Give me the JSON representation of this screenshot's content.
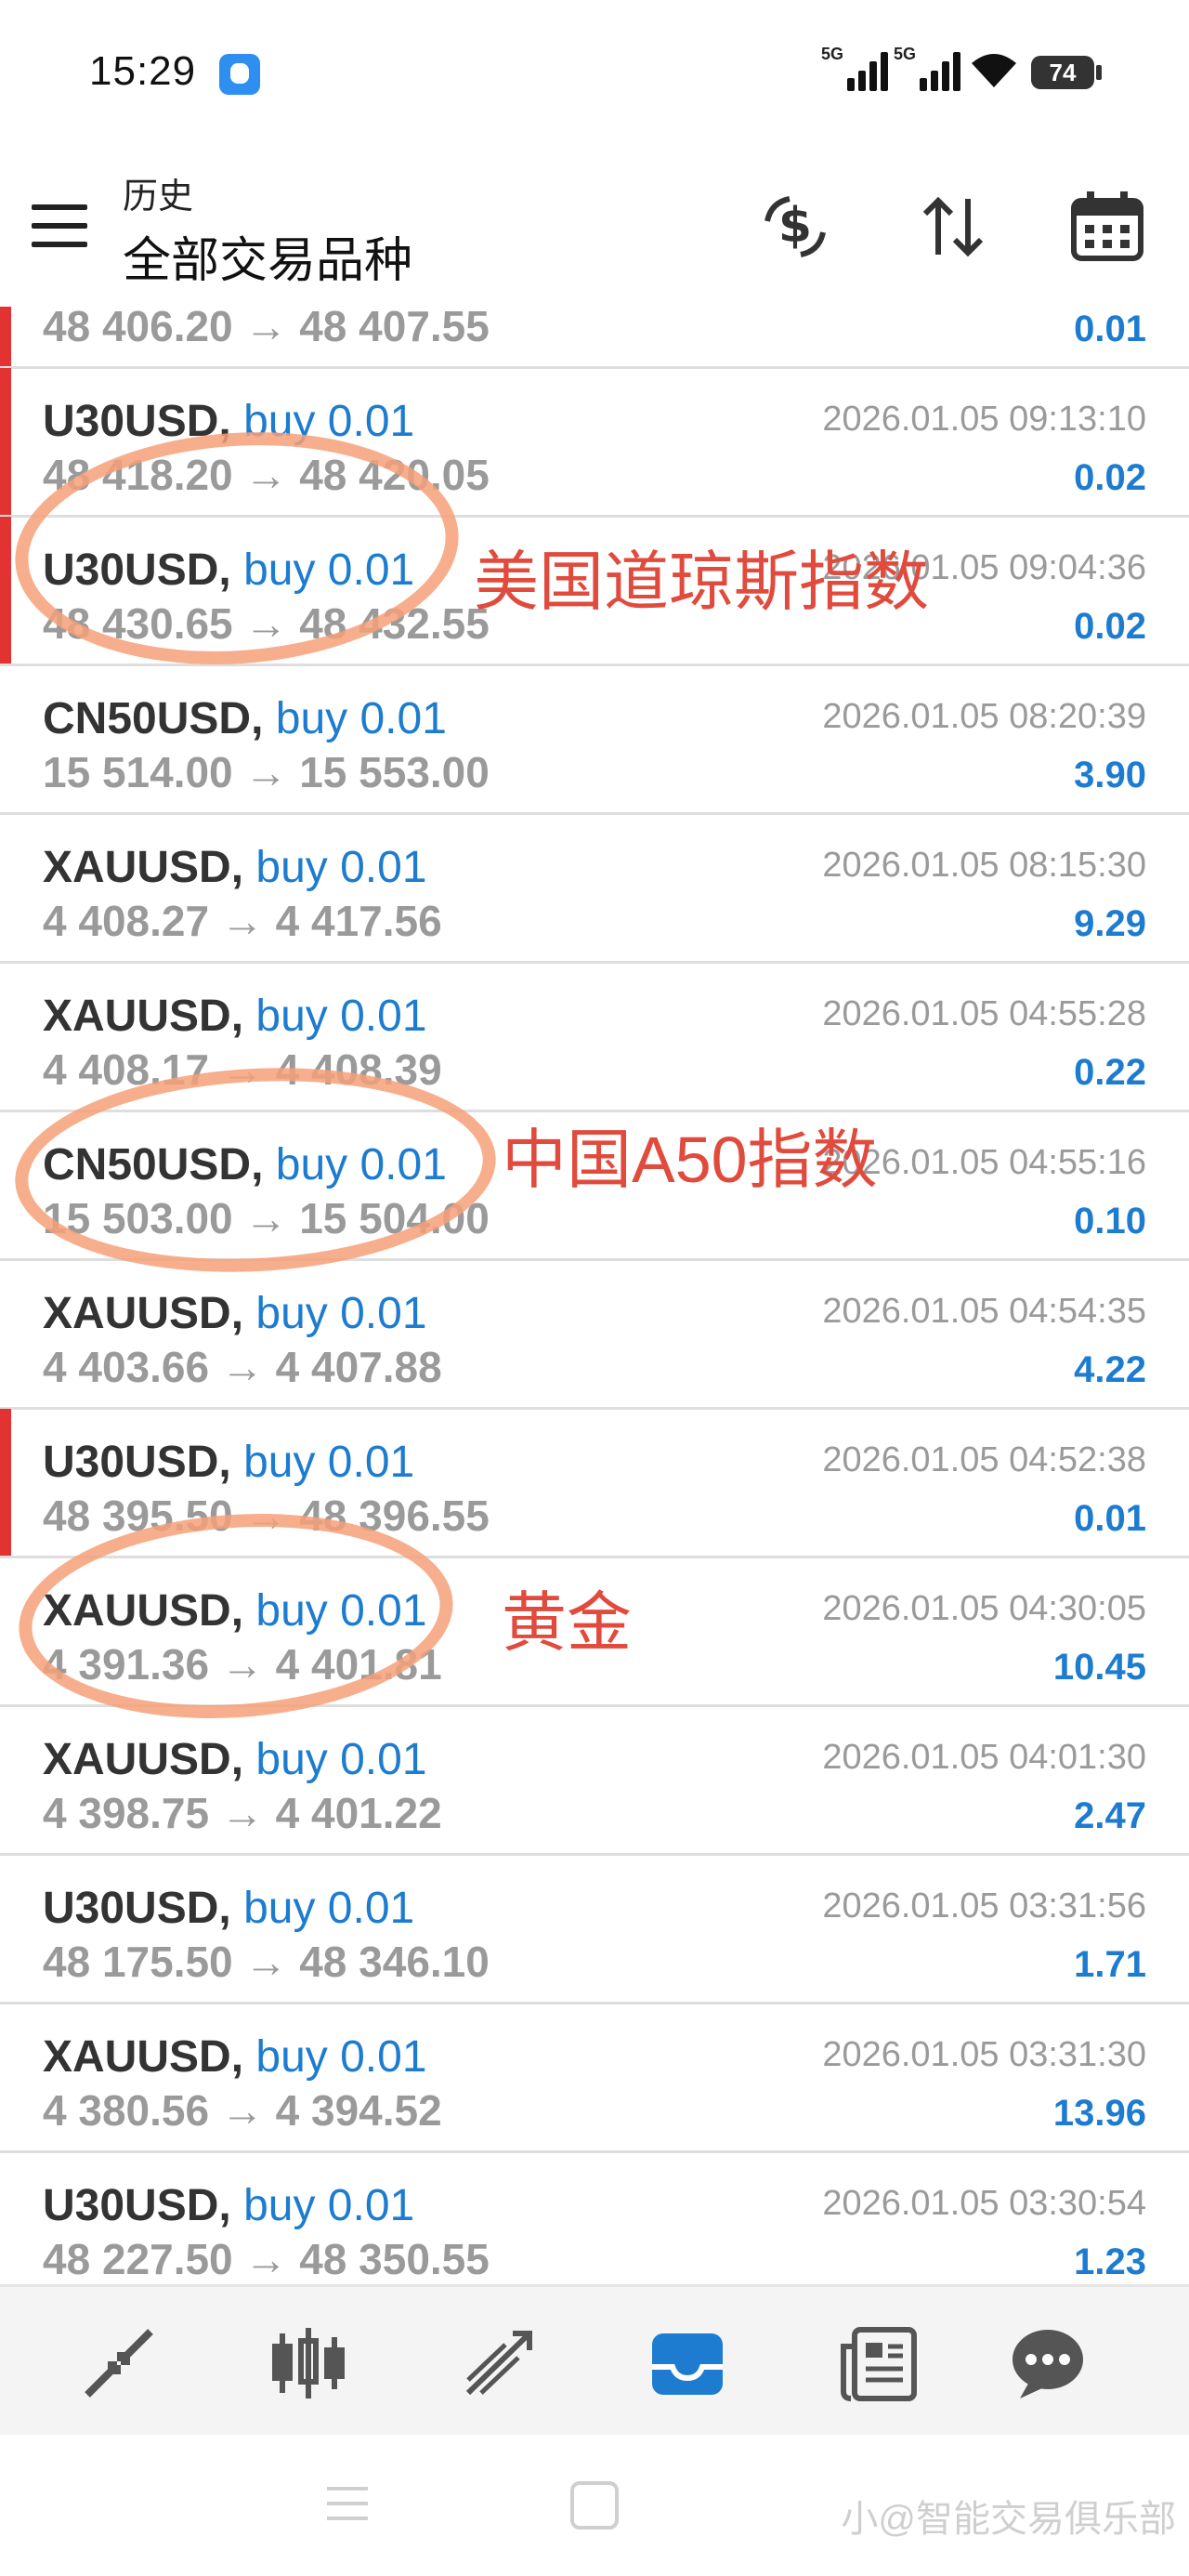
{
  "status_bar": {
    "time": "15:29",
    "signal1": "5G",
    "signal2": "5G",
    "battery": "74"
  },
  "header": {
    "title": "历史",
    "subtitle": "全部交易品种"
  },
  "colors": {
    "accent_blue": "#1d7ccf",
    "loss_marker_red": "#e23232",
    "annotation_red": "#e04b3d",
    "annotation_ring": "#f6a078",
    "text_gray": "#9a9a9a"
  },
  "trades": [
    {
      "symbol": "",
      "type": "",
      "price": "48 406.20 → 48 407.55",
      "time": "",
      "profit": "0.01",
      "marker": true
    },
    {
      "symbol": "U30USD,",
      "type": "buy 0.01",
      "price": "48 418.20 → 48 420.05",
      "time": "2026.01.05 09:13:10",
      "profit": "0.02",
      "marker": true
    },
    {
      "symbol": "U30USD,",
      "type": "buy 0.01",
      "price": "48 430.65 → 48 432.55",
      "time": "2026.01.05 09:04:36",
      "profit": "0.02",
      "marker": true
    },
    {
      "symbol": "CN50USD,",
      "type": "buy 0.01",
      "price": "15 514.00 → 15 553.00",
      "time": "2026.01.05 08:20:39",
      "profit": "3.90",
      "marker": false
    },
    {
      "symbol": "XAUUSD,",
      "type": "buy 0.01",
      "price": "4 408.27 → 4 417.56",
      "time": "2026.01.05 08:15:30",
      "profit": "9.29",
      "marker": false
    },
    {
      "symbol": "XAUUSD,",
      "type": "buy 0.01",
      "price": "4 408.17 → 4 408.39",
      "time": "2026.01.05 04:55:28",
      "profit": "0.22",
      "marker": false
    },
    {
      "symbol": "CN50USD,",
      "type": "buy 0.01",
      "price": "15 503.00 → 15 504.00",
      "time": "2026.01.05 04:55:16",
      "profit": "0.10",
      "marker": false
    },
    {
      "symbol": "XAUUSD,",
      "type": "buy 0.01",
      "price": "4 403.66 → 4 407.88",
      "time": "2026.01.05 04:54:35",
      "profit": "4.22",
      "marker": false
    },
    {
      "symbol": "U30USD,",
      "type": "buy 0.01",
      "price": "48 395.50 → 48 396.55",
      "time": "2026.01.05 04:52:38",
      "profit": "0.01",
      "marker": true
    },
    {
      "symbol": "XAUUSD,",
      "type": "buy 0.01",
      "price": "4 391.36 → 4 401.81",
      "time": "2026.01.05 04:30:05",
      "profit": "10.45",
      "marker": false
    },
    {
      "symbol": "XAUUSD,",
      "type": "buy 0.01",
      "price": "4 398.75 → 4 401.22",
      "time": "2026.01.05 04:01:30",
      "profit": "2.47",
      "marker": false
    },
    {
      "symbol": "U30USD,",
      "type": "buy 0.01",
      "price": "48 175.50 → 48 346.10",
      "time": "2026.01.05 03:31:56",
      "profit": "1.71",
      "marker": false
    },
    {
      "symbol": "XAUUSD,",
      "type": "buy 0.01",
      "price": "4 380.56 → 4 394.52",
      "time": "2026.01.05 03:31:30",
      "profit": "13.96",
      "marker": false
    },
    {
      "symbol": "U30USD,",
      "type": "buy 0.01",
      "price": "48 227.50 → 48 350.55",
      "time": "2026.01.05 03:30:54",
      "profit": "1.23",
      "marker": false
    }
  ],
  "annotations": {
    "dow": "美国道琼斯指数",
    "a50": "中国A50指数",
    "gold": "黄金"
  },
  "tabs": [
    "quotes-icon",
    "chart-icon",
    "trade-icon",
    "history-icon",
    "news-icon",
    "chat-icon"
  ],
  "watermark": "小@智能交易俱乐部"
}
